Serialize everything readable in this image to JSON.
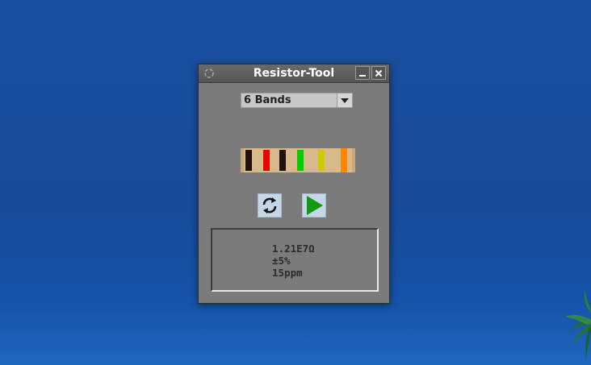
{
  "window": {
    "title": "Resistor-Tool",
    "controls": {
      "app_icon": "app-menu-icon",
      "minimize_icon": "minimize-icon",
      "close_icon": "close-icon"
    }
  },
  "band_selector": {
    "value": "6 Bands",
    "dropdown_icon": "chevron-down-icon"
  },
  "resistor": {
    "body_color": "#d8b98c",
    "bands": [
      {
        "name": "black",
        "color": "#1e1208"
      },
      {
        "name": "red",
        "color": "#ee0000"
      },
      {
        "name": "black",
        "color": "#1e1208"
      },
      {
        "name": "green",
        "color": "#00cc00"
      },
      {
        "name": "gold",
        "color": "#cccc00"
      },
      {
        "name": "orange",
        "color": "#ff8800"
      }
    ]
  },
  "buttons": {
    "refresh": {
      "icon": "refresh-icon"
    },
    "play": {
      "icon": "play-icon"
    }
  },
  "result": {
    "resistance": "1.21E7Ω",
    "tolerance": "±5%",
    "temp_coefficient": "15ppm"
  }
}
